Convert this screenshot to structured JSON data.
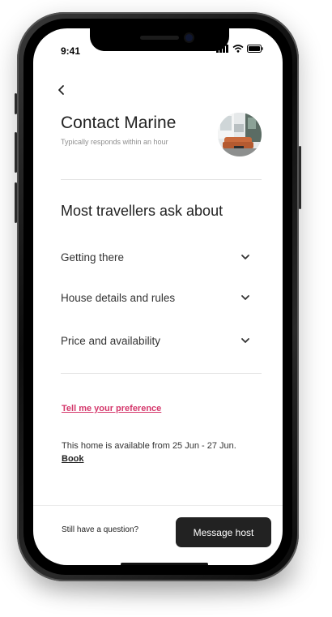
{
  "status_bar": {
    "time": "9:41"
  },
  "nav": {
    "back_icon": "chevron-left-icon",
    "back_glyph": "‹"
  },
  "header": {
    "title": "Contact Marine",
    "subtitle": "Typically responds within an hour"
  },
  "faq": {
    "title": "Most travellers ask about",
    "items": [
      {
        "label": "Getting there",
        "icon": "chevron-down-icon"
      },
      {
        "label": "House details and rules",
        "icon": "chevron-down-icon"
      },
      {
        "label": "Price and availability",
        "icon": "chevron-down-icon"
      }
    ]
  },
  "preference_link": "Tell me your preference",
  "availability": {
    "text": "This home is available from 25 Jun - 27 Jun.",
    "book_label": "Book"
  },
  "footer": {
    "question": "Still have a question?",
    "message_button": "Message host"
  },
  "colors": {
    "accent": "#d4376b",
    "button_bg": "#222222",
    "text": "#222222",
    "muted": "#8e8e8e"
  }
}
